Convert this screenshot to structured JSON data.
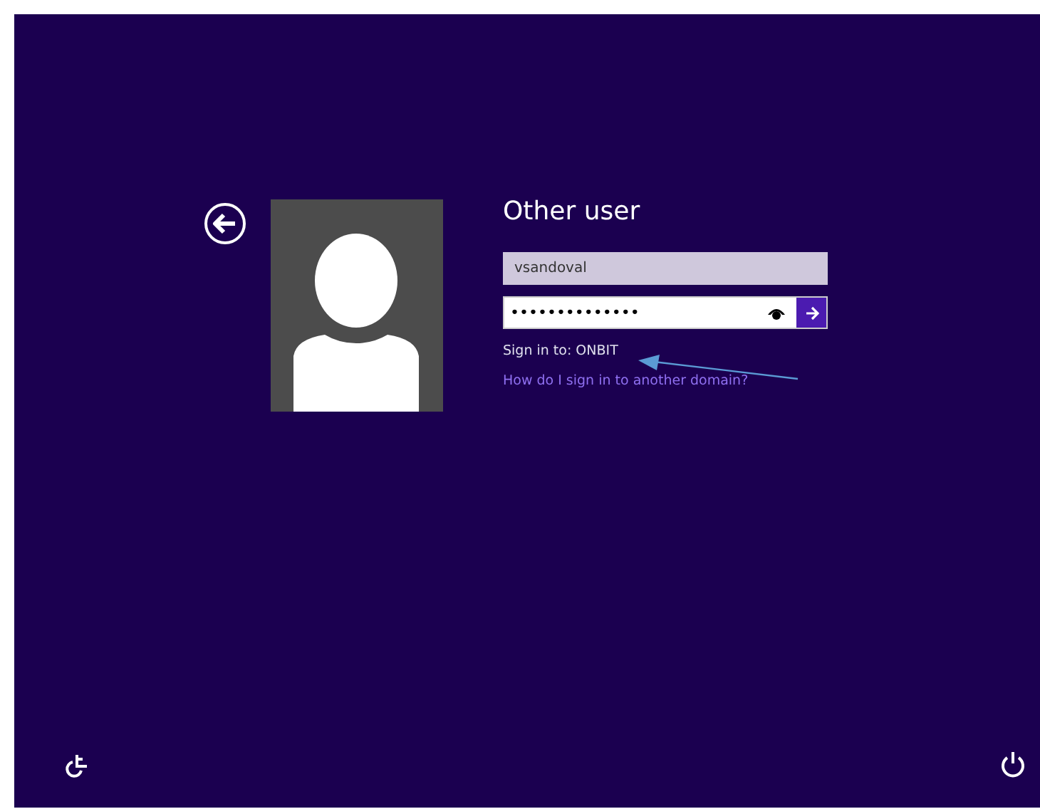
{
  "tile": {
    "title": "Other user"
  },
  "username": {
    "value": "vsandoval"
  },
  "password": {
    "value": "••••••••••••••"
  },
  "sign_in_to": "Sign in to: ONBIT",
  "help_link": "How do I sign in to another domain?"
}
